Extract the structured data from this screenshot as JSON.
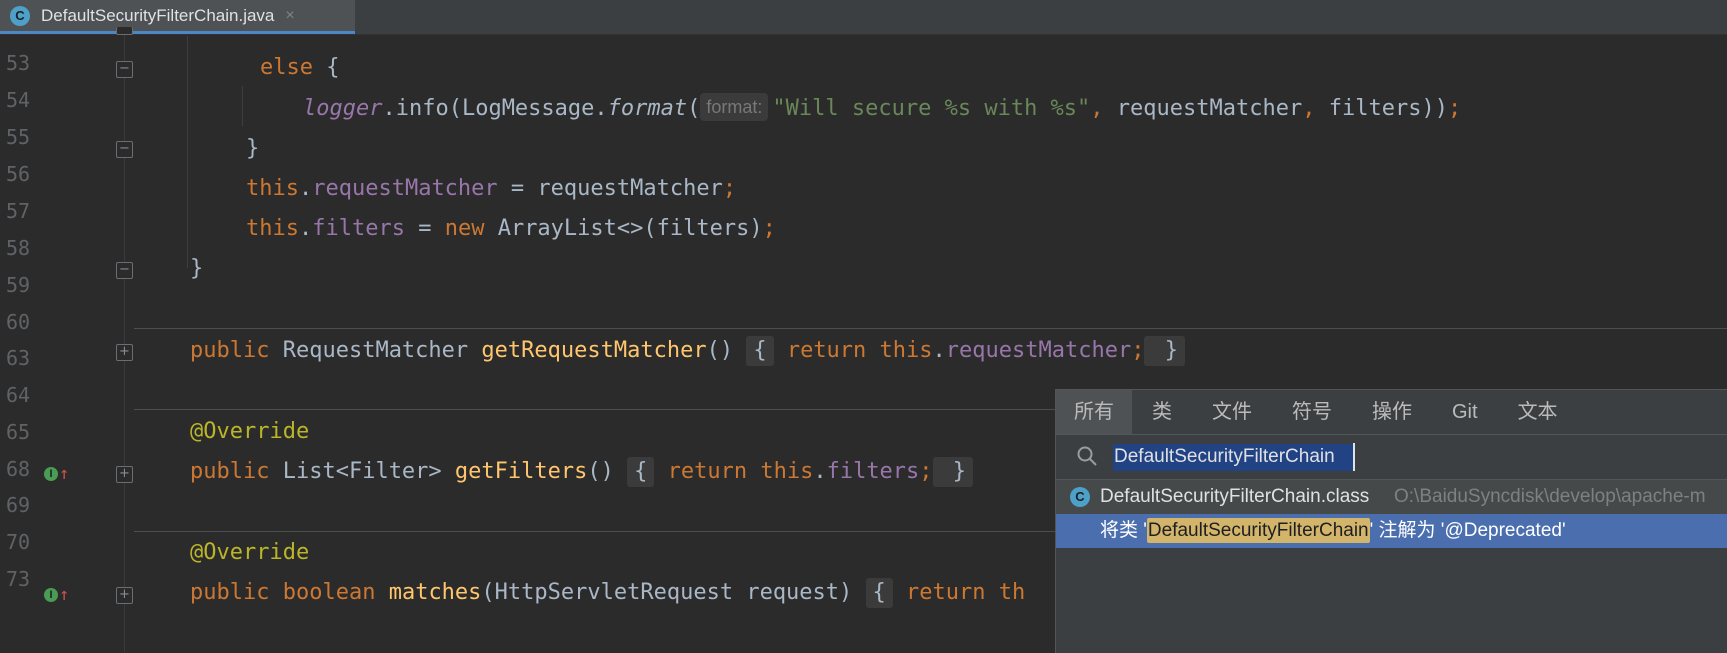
{
  "tab": {
    "icon": "class-icon",
    "icon_letter": "C",
    "title": "DefaultSecurityFilterChain.java",
    "close": "×"
  },
  "gutter": {
    "line_numbers": [
      "53",
      "54",
      "55",
      "56",
      "57",
      "58",
      "59",
      "60",
      "63",
      "64",
      "65",
      "68",
      "69",
      "70",
      "73"
    ],
    "impl_marker_letter": "I",
    "impl_marker_arrow": "↑"
  },
  "code": {
    "l53": {
      "kw_else": "else",
      "rest": " {"
    },
    "l54": {
      "logger": "logger",
      "dot_info": ".info(LogMessage.",
      "format": "format",
      "paren": "(",
      "hint": "format:",
      "str": "\"Will secure %s with %s\"",
      "comma1": ",",
      "args": " requestMatcher",
      "comma2": ",",
      "args2": " filters))",
      "semi": ";"
    },
    "l55": {
      "text": "}"
    },
    "l56": {
      "kw_this": "this",
      "dot": ".",
      "field": "requestMatcher",
      "rest": " = requestMatcher",
      "semi": ";"
    },
    "l57": {
      "kw_this": "this",
      "dot": ".",
      "field": "filters",
      "eq": " = ",
      "kw_new": "new",
      "rest": " ArrayList<>(filters)",
      "semi": ";"
    },
    "l58": {
      "text": "}"
    },
    "l60": {
      "kw_public": "public",
      "type": " RequestMatcher ",
      "fn": "getRequestMatcher",
      "paren": "() ",
      "lbrace": "{",
      "kw_return": " return",
      "sp": " ",
      "kw_this": "this",
      "dot": ".",
      "field": "requestMatcher",
      "semi": ";",
      "rbrace": " }"
    },
    "l64": {
      "ann": "@Override"
    },
    "l65": {
      "kw_public": "public",
      "type": " List<Filter> ",
      "fn": "getFilters",
      "paren": "() ",
      "lbrace": "{",
      "kw_return": " return",
      "sp": " ",
      "kw_this": "this",
      "dot": ".",
      "field": "filters",
      "semi": ";",
      "rbrace": " }"
    },
    "l69": {
      "ann": "@Override"
    },
    "l70": {
      "kw_public": "public",
      "sp1": " ",
      "kw_boolean": "boolean",
      "sp2": " ",
      "fn": "matches",
      "rest": "(HttpServletRequest request) ",
      "lbrace": "{",
      "kw_return": " return",
      "trail": " th"
    }
  },
  "popup": {
    "tabs": [
      "所有",
      "类",
      "文件",
      "符号",
      "操作",
      "Git",
      "文本"
    ],
    "search_icon": "search-icon",
    "search_value": "DefaultSecurityFilterChain",
    "results": [
      {
        "icon": "class-icon",
        "icon_letter": "C",
        "name": "DefaultSecurityFilterChain.class",
        "path": "O:\\BaiduSyncdisk\\develop\\apache-m"
      },
      {
        "prefix": "将类 '",
        "match": "DefaultSecurityFilterChain",
        "suffix": "' 注解为 '@Deprecated'"
      }
    ]
  },
  "colors": {
    "editor_bg": "#2b2b2b",
    "keyword": "#cc7832",
    "field": "#9876aa",
    "method": "#ffc66d",
    "string": "#6a8759",
    "annotation": "#bbb529",
    "selection": "#4b6eaf",
    "match_highlight": "#d2b56b"
  }
}
